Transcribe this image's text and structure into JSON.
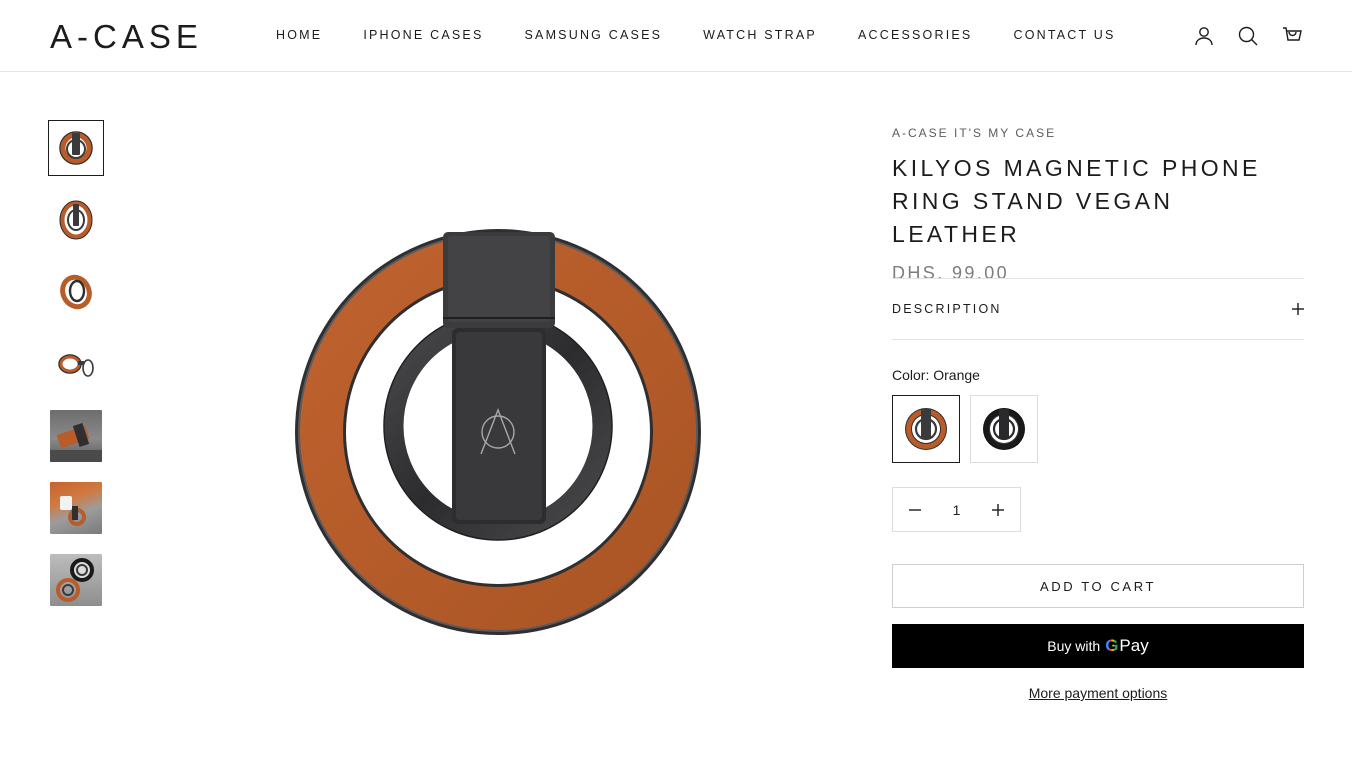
{
  "header": {
    "logo": "A-CASE",
    "nav": [
      {
        "label": "HOME"
      },
      {
        "label": "IPHONE CASES"
      },
      {
        "label": "SAMSUNG CASES"
      },
      {
        "label": "WATCH STRAP"
      },
      {
        "label": "ACCESSORIES"
      },
      {
        "label": "CONTACT US"
      }
    ],
    "icons": [
      "account-icon",
      "search-icon",
      "cart-icon"
    ]
  },
  "gallery": {
    "thumbnails": [
      {
        "icon": "orange-ring-front",
        "selected": true
      },
      {
        "icon": "orange-ring-angle",
        "selected": false
      },
      {
        "icon": "orange-ring-tilted",
        "selected": false
      },
      {
        "icon": "ring-side",
        "selected": false
      },
      {
        "icon": "lifestyle-stand-photo",
        "selected": false
      },
      {
        "icon": "lifestyle-hand-photo",
        "selected": false
      },
      {
        "icon": "black-and-orange-rings-photo",
        "selected": false
      }
    ],
    "main_image": "orange-magnetic-ring-stand"
  },
  "product": {
    "vendor": "A-CASE IT'S MY CASE",
    "title": "KILYOS MAGNETIC PHONE RING STAND VEGAN LEATHER",
    "price": "DHS. 99.00",
    "description_label": "DESCRIPTION",
    "color_label": "Color:",
    "color_value": "Orange",
    "swatches": [
      {
        "name": "Orange",
        "color": "#b85c2a",
        "selected": true
      },
      {
        "name": "Black",
        "color": "#1a1a1a",
        "selected": false
      }
    ],
    "quantity": "1",
    "add_to_cart": "ADD TO CART",
    "gpay_prefix": "Buy with",
    "gpay_g": "G",
    "gpay_word": "Pay",
    "more_payment": "More payment options"
  },
  "colors": {
    "leather": "#b85c2a",
    "metal": "#3a3a3c",
    "text": "#1c1c1c",
    "muted": "#7d7d7d"
  }
}
